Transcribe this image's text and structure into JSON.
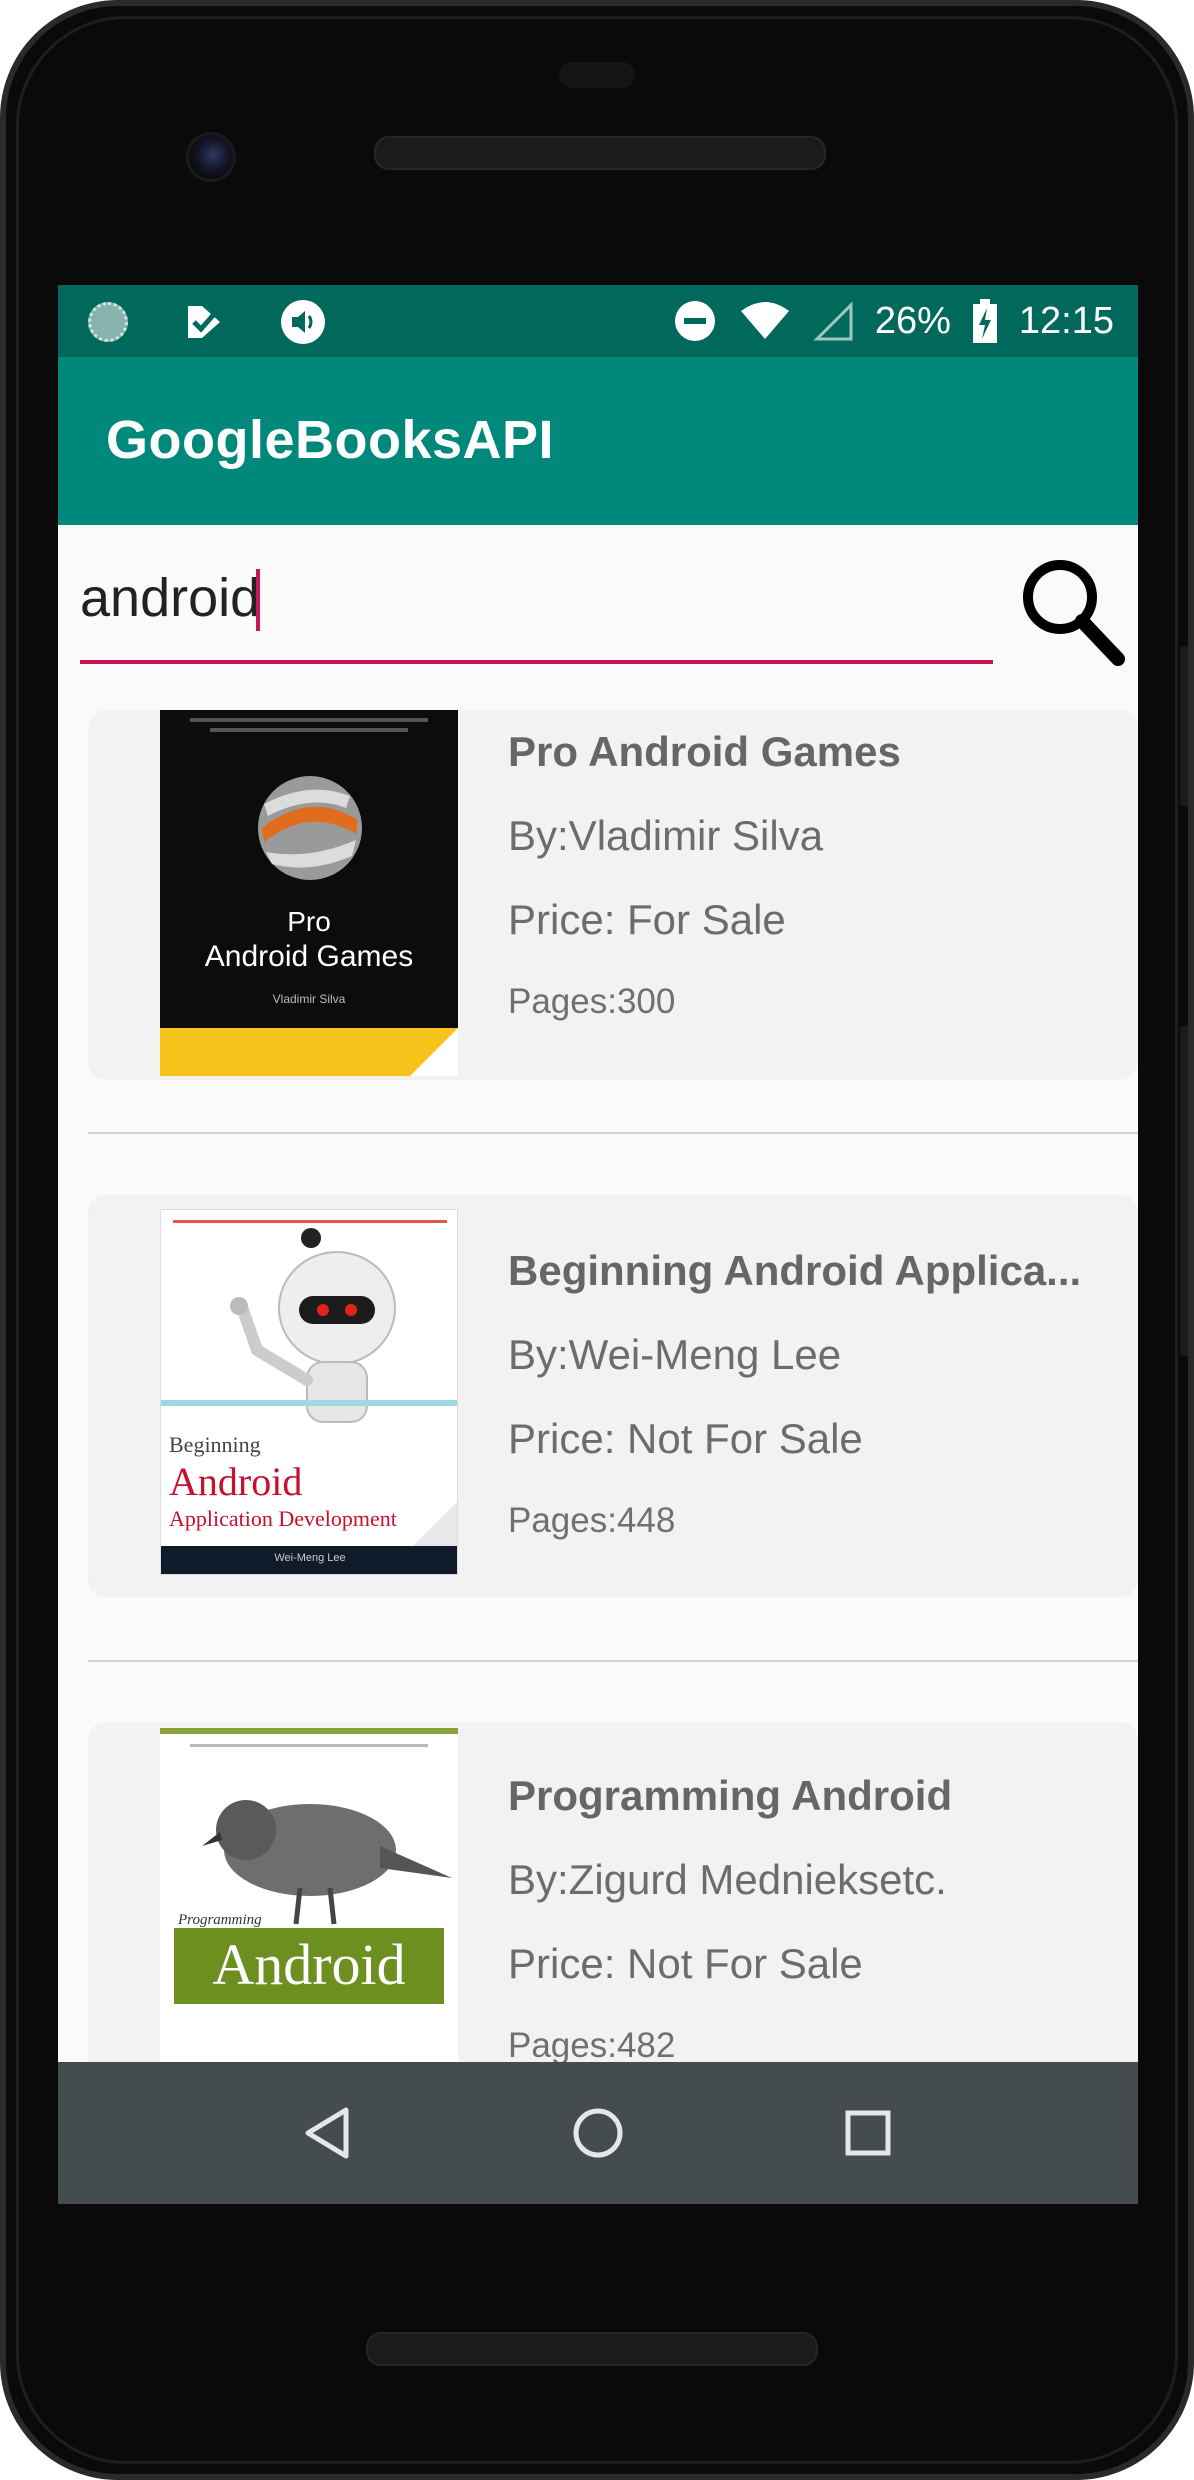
{
  "status_bar": {
    "battery": "26%",
    "time": "12:15"
  },
  "app_bar": {
    "title": "GoogleBooksAPI"
  },
  "search": {
    "value": "android"
  },
  "books": [
    {
      "title": "Pro Android Games",
      "author": "By:Vladimir Silva",
      "price": "Price: For Sale",
      "pages": "Pages:300",
      "cover": {
        "title_line1": "Pro",
        "title_line2": "Android Games",
        "author": "Vladimir Silva"
      }
    },
    {
      "title": "Beginning Android Applica...",
      "author": "By:Wei-Meng Lee",
      "price": "Price: Not For Sale",
      "pages": "Pages:448",
      "cover": {
        "line1": "Beginning",
        "line2": "Android",
        "line3": "Application Development",
        "author": "Wei-Meng Lee"
      }
    },
    {
      "title": "Programming Android",
      "author": "By:Zigurd Mednieksetc.",
      "price": "Price: Not For Sale",
      "pages": "Pages:482",
      "cover": {
        "small": "Programming",
        "big": "Android"
      }
    }
  ],
  "colors": {
    "status_bar": "#00695c",
    "app_bar": "#00897b",
    "accent": "#c2185b",
    "nav_bar": "#454c50"
  }
}
